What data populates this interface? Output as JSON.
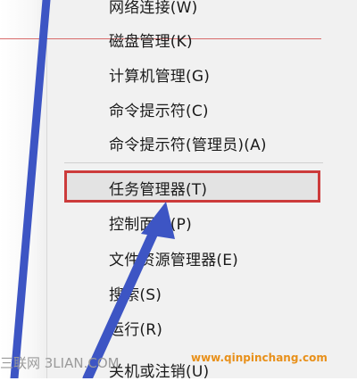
{
  "context_menu": {
    "items": [
      {
        "label": "网络连接(W)"
      },
      {
        "label": "磁盘管理(K)"
      },
      {
        "label": "计算机管理(G)"
      },
      {
        "label": "命令提示符(C)"
      },
      {
        "label": "命令提示符(管理员)(A)"
      },
      {
        "label": "任务管理器(T)",
        "highlighted": true
      },
      {
        "label": "控制面板(P)"
      },
      {
        "label": "文件资源管理器(E)"
      },
      {
        "label": "搜索(S)"
      },
      {
        "label": "运行(R)"
      },
      {
        "label": "关机或注销(U)"
      }
    ]
  },
  "watermarks": {
    "left": "三联网 3LIAN.COM",
    "right": "www.qinpinchang.com"
  },
  "colors": {
    "highlight_border": "#cc3b3b",
    "arrow": "#3d55c4",
    "watermark_orange": "#e8901a"
  }
}
